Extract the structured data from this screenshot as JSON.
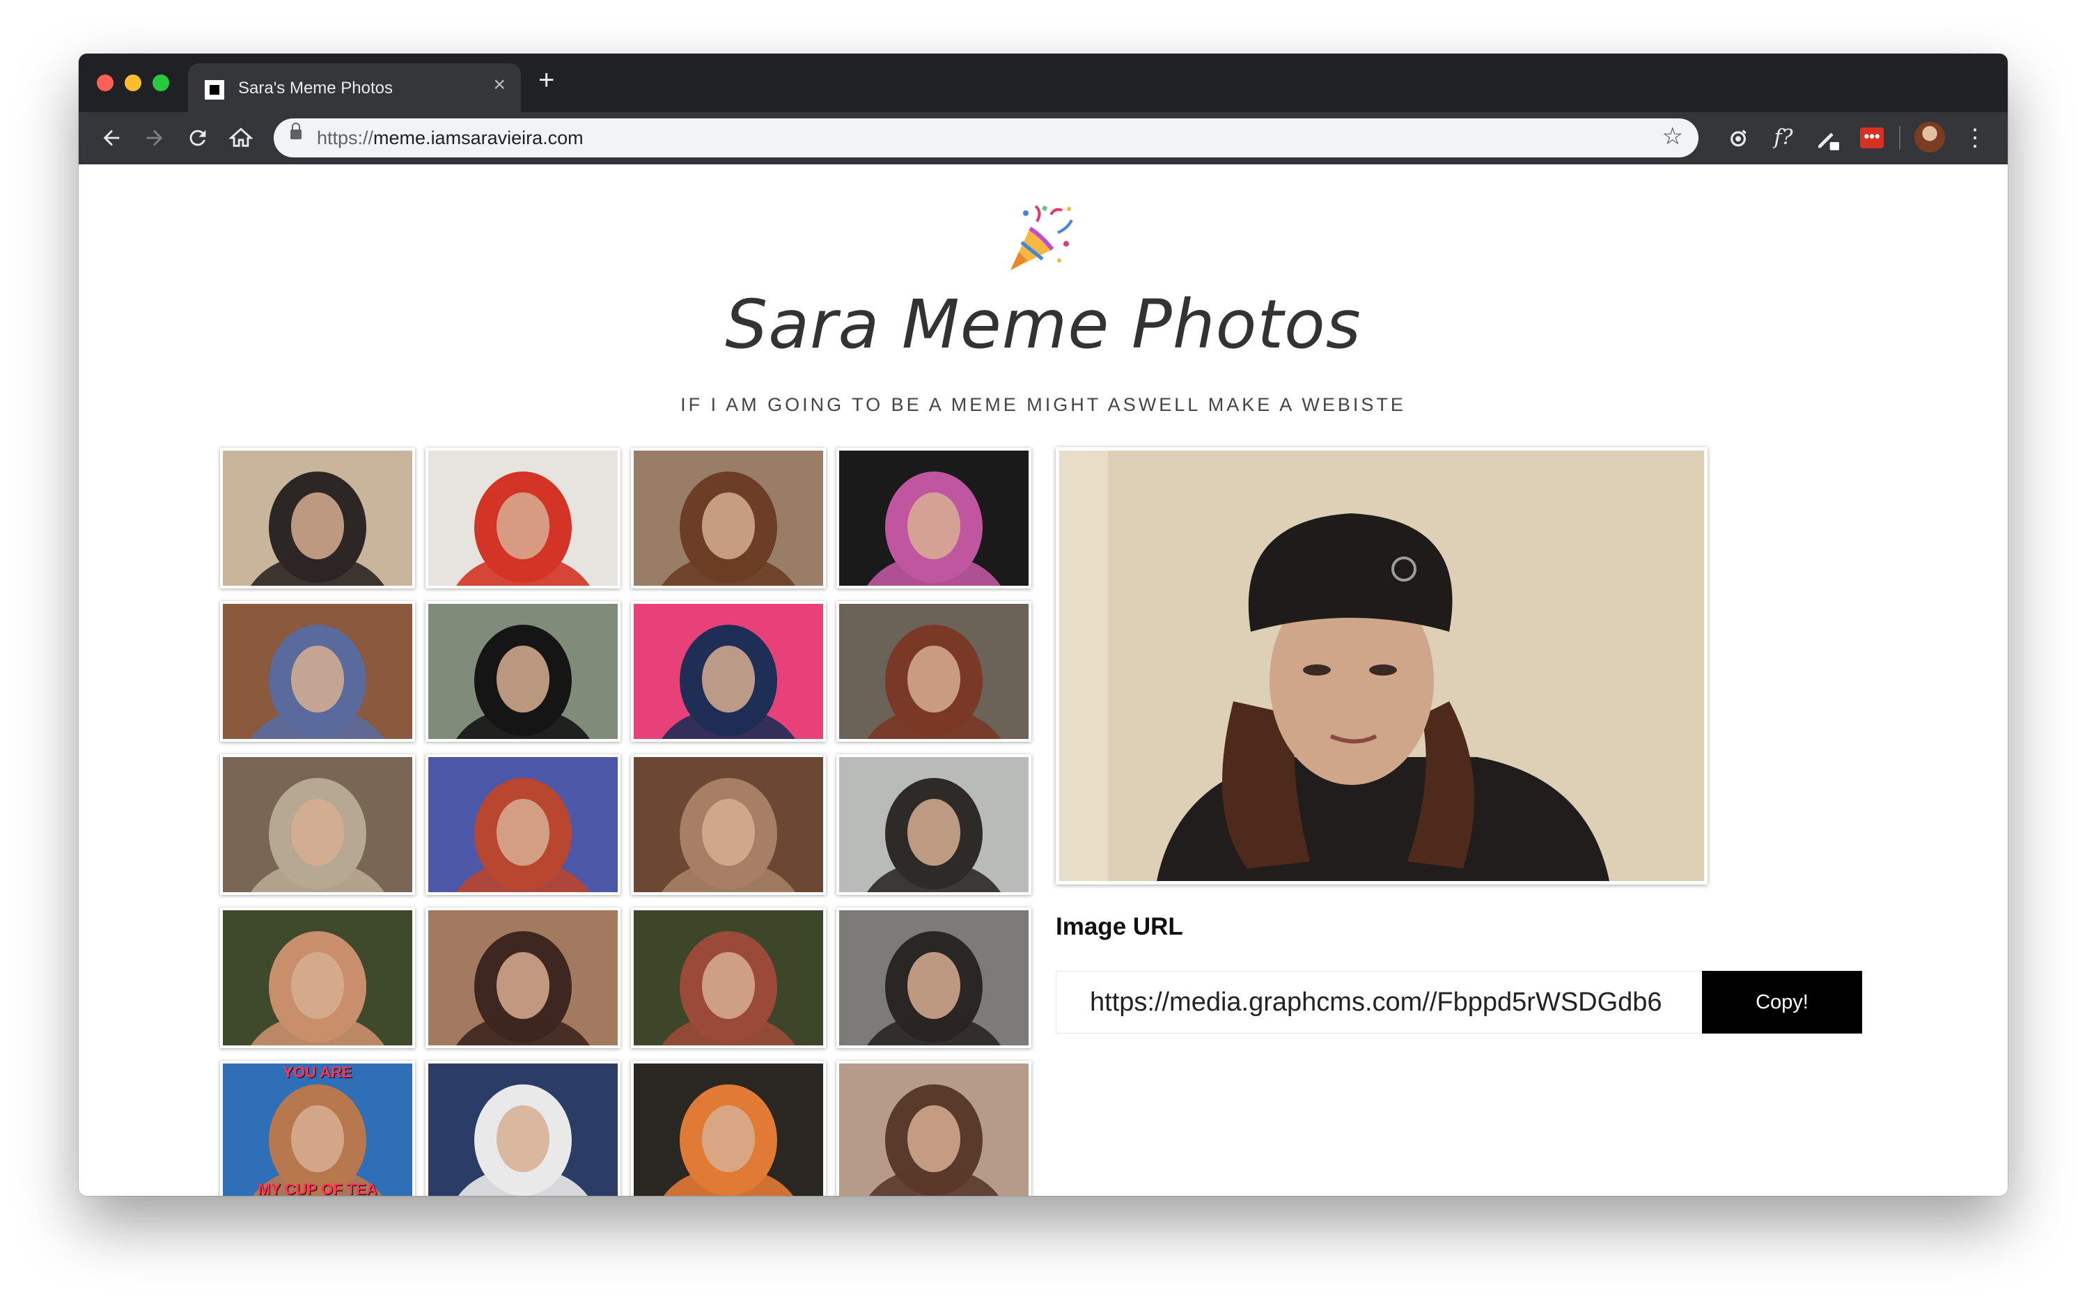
{
  "browser": {
    "tab_title": "Sara's Meme Photos",
    "url_scheme": "https://",
    "url_host": "meme.iamsaravieira.com",
    "new_tab_label": "+",
    "tab_close_label": "×",
    "extensions": [
      "camera-extension-icon",
      "fontface-extension-icon",
      "pen-extension-icon",
      "lastpass-extension-icon"
    ],
    "ext_font_label": "f?",
    "ext_red_label": "•••"
  },
  "header": {
    "emoji": "party-popper-icon",
    "title": "Sara Meme Photos",
    "tagline": "IF I AM GOING TO BE A MEME MIGHT ASWELL MAKE A WEBISTE"
  },
  "gallery": {
    "thumbnails": [
      {
        "name": "photo-beanie-portrait",
        "bg": "#c8b59b",
        "fg": "#2c2624"
      },
      {
        "name": "photo-meeting-room",
        "bg": "#e7e4df",
        "fg": "#d33426"
      },
      {
        "name": "photo-closeup-frown",
        "bg": "#9a7d66",
        "fg": "#6c3e25"
      },
      {
        "name": "photo-stage-talk",
        "bg": "#1a1a1a",
        "fg": "#c056a0"
      },
      {
        "name": "photo-distorted-face",
        "bg": "#8b5a3c",
        "fg": "#5a6a9c"
      },
      {
        "name": "photo-deal-with-it-glasses",
        "bg": "#7f8c7a",
        "fg": "#151515"
      },
      {
        "name": "photo-pink-backdrop",
        "bg": "#e8417a",
        "fg": "#1f2e55"
      },
      {
        "name": "photo-selfie-pair",
        "bg": "#6b6258",
        "fg": "#7a3826"
      },
      {
        "name": "photo-teddy-bear",
        "bg": "#7a6654",
        "fg": "#b7a891"
      },
      {
        "name": "photo-stickers-laptop",
        "bg": "#4e58a8",
        "fg": "#b9462f"
      },
      {
        "name": "photo-stare",
        "bg": "#6b4734",
        "fg": "#a67f64"
      },
      {
        "name": "photo-audience",
        "bg": "#b9bbb8",
        "fg": "#2d2a28"
      },
      {
        "name": "photo-park-stretched",
        "bg": "#3f4a2a",
        "fg": "#c88f6c"
      },
      {
        "name": "photo-side-eye",
        "bg": "#a17a60",
        "fg": "#3d2720"
      },
      {
        "name": "photo-park-smile",
        "bg": "#3d4628",
        "fg": "#9b4a38"
      },
      {
        "name": "photo-eating-lunch",
        "bg": "#7c7b78",
        "fg": "#2a2624"
      },
      {
        "name": "photo-cup-of-tea",
        "bg": "#2f6fb8",
        "fg": "#b7784d",
        "caption_top": "YOU ARE",
        "caption_bottom": "MY CUP OF TEA"
      },
      {
        "name": "photo-sweater",
        "bg": "#2b3d66",
        "fg": "#e9e9e9"
      },
      {
        "name": "photo-stage-chair",
        "bg": "#2a2622",
        "fg": "#e07a35"
      },
      {
        "name": "photo-pixelated",
        "bg": "#b59b88",
        "fg": "#5a3a2a"
      }
    ]
  },
  "preview": {
    "name": "selected-photo-preview",
    "bg": "#ddd0b6"
  },
  "image_url": {
    "label": "Image URL",
    "value": "https://media.graphcms.com//Fbppd5rWSDGdb6",
    "copy_label": "Copy!"
  },
  "colors": {
    "chrome_dark": "#202124",
    "chrome_toolbar": "#35363a",
    "copy_button": "#000000"
  }
}
